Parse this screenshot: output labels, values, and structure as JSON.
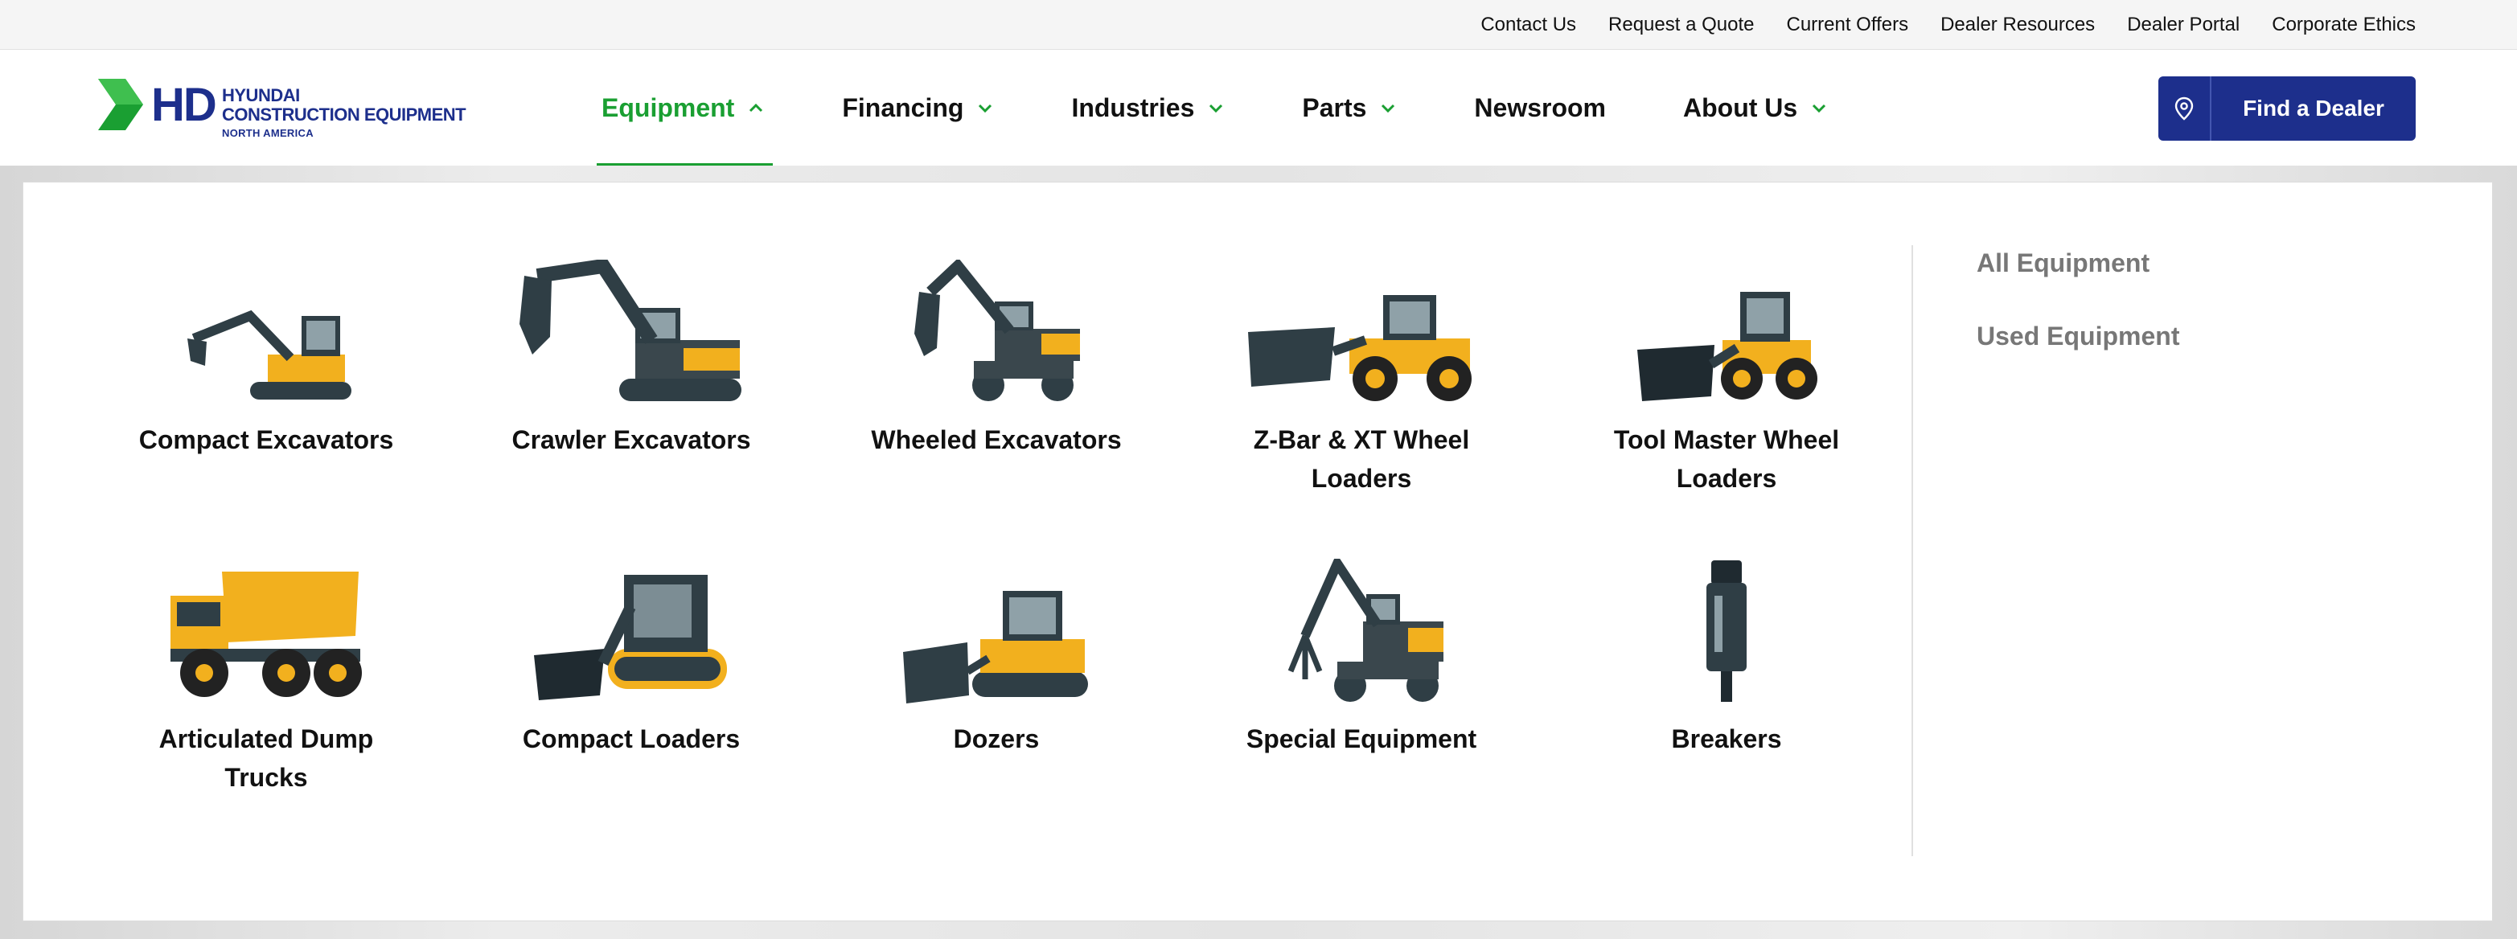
{
  "utility_bar": {
    "links": [
      "Contact Us",
      "Request a Quote",
      "Current Offers",
      "Dealer Resources",
      "Dealer Portal",
      "Corporate Ethics"
    ]
  },
  "logo": {
    "mark": "HD",
    "line1": "HYUNDAI",
    "line2": "CONSTRUCTION EQUIPMENT",
    "line3": "NORTH AMERICA"
  },
  "nav": {
    "items": [
      {
        "label": "Equipment",
        "has_dropdown": true,
        "active": true
      },
      {
        "label": "Financing",
        "has_dropdown": true
      },
      {
        "label": "Industries",
        "has_dropdown": true
      },
      {
        "label": "Parts",
        "has_dropdown": true
      },
      {
        "label": "Newsroom",
        "has_dropdown": false
      },
      {
        "label": "About Us",
        "has_dropdown": true
      }
    ]
  },
  "find_dealer": {
    "label": "Find a Dealer",
    "icon": "location-pin-icon"
  },
  "dropdown": {
    "categories": [
      {
        "label": "Compact Excavators",
        "icon": "compact-excavator-icon"
      },
      {
        "label": "Crawler Excavators",
        "icon": "crawler-excavator-icon"
      },
      {
        "label": "Wheeled Excavators",
        "icon": "wheeled-excavator-icon"
      },
      {
        "label": "Z-Bar & XT Wheel Loaders",
        "icon": "wheel-loader-icon"
      },
      {
        "label": "Tool Master Wheel Loaders",
        "icon": "tool-master-loader-icon"
      },
      {
        "label": "Articulated Dump Trucks",
        "icon": "dump-truck-icon"
      },
      {
        "label": "Compact Loaders",
        "icon": "compact-loader-icon"
      },
      {
        "label": "Dozers",
        "icon": "dozer-icon"
      },
      {
        "label": "Special Equipment",
        "icon": "material-handler-icon"
      },
      {
        "label": "Breakers",
        "icon": "breaker-icon"
      }
    ],
    "side_links": [
      "All Equipment",
      "Used Equipment"
    ]
  },
  "colors": {
    "brand_blue": "#1d2f8c",
    "brand_green": "#1a9f32",
    "machine_yellow": "#f2b01e",
    "machine_dark": "#2f3e45"
  }
}
